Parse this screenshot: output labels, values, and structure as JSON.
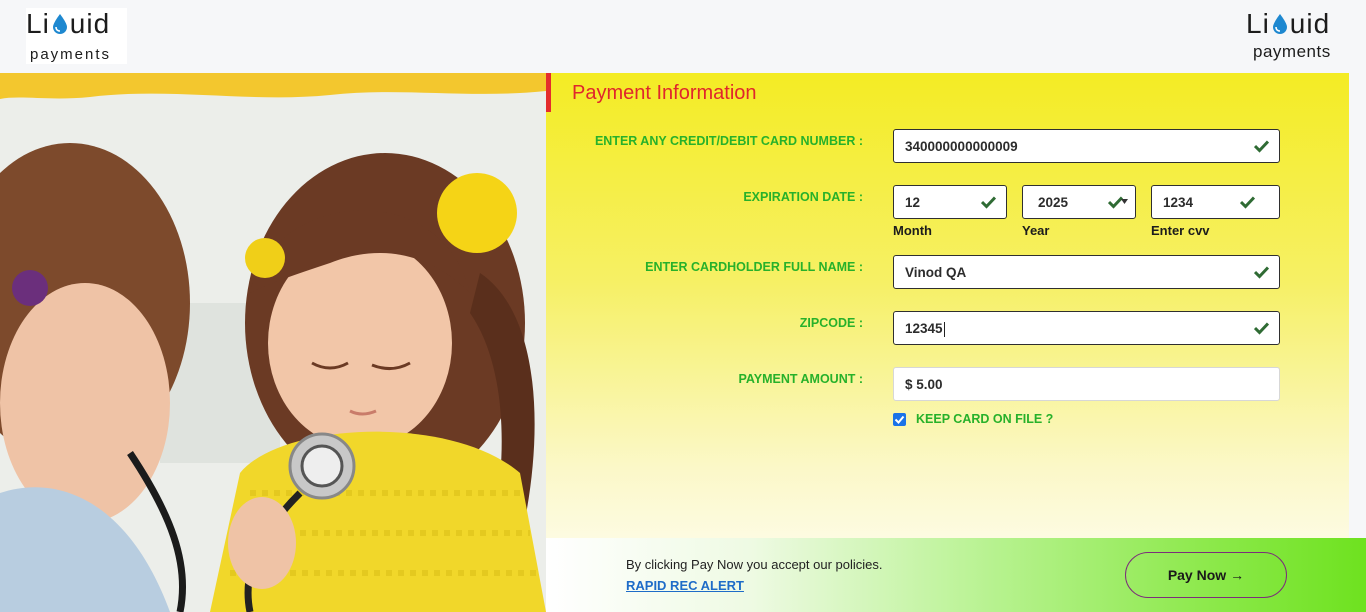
{
  "brand": {
    "logo_left_word": "Li",
    "logo_left_word_end": "uid",
    "logo_left_sub": "payments",
    "logo_right_word": "Li",
    "logo_right_word_end": "uid",
    "logo_right_sub": "payments"
  },
  "form": {
    "title": "Payment Information",
    "card_label": "ENTER ANY CREDIT/DEBIT CARD NUMBER :",
    "card_value": "340000000000009",
    "exp_label": "EXPIRATION DATE :",
    "month_value": "12",
    "month_label": "Month",
    "year_value": "2025",
    "year_label": "Year",
    "cvv_value": "1234",
    "cvv_label": "Enter cvv",
    "name_label": "ENTER CARDHOLDER FULL NAME :",
    "name_value": "Vinod QA",
    "zip_label": "ZIPCODE :",
    "zip_value": "12345",
    "amount_label": "PAYMENT AMOUNT :",
    "amount_value": "$ 5.00",
    "keep_card_label": "KEEP CARD ON FILE ?",
    "keep_card_checked": true
  },
  "footer": {
    "policy_text": "By clicking Pay Now you accept our policies.",
    "alert_link": "RAPID REC ALERT",
    "pay_button": "Pay Now",
    "pay_arrow": "→"
  },
  "colors": {
    "title_red": "#e0262c",
    "label_green": "#27b12a",
    "check_green": "#2f6b34",
    "link_blue": "#1e6cc8",
    "drop_blue": "#1e88d0"
  }
}
